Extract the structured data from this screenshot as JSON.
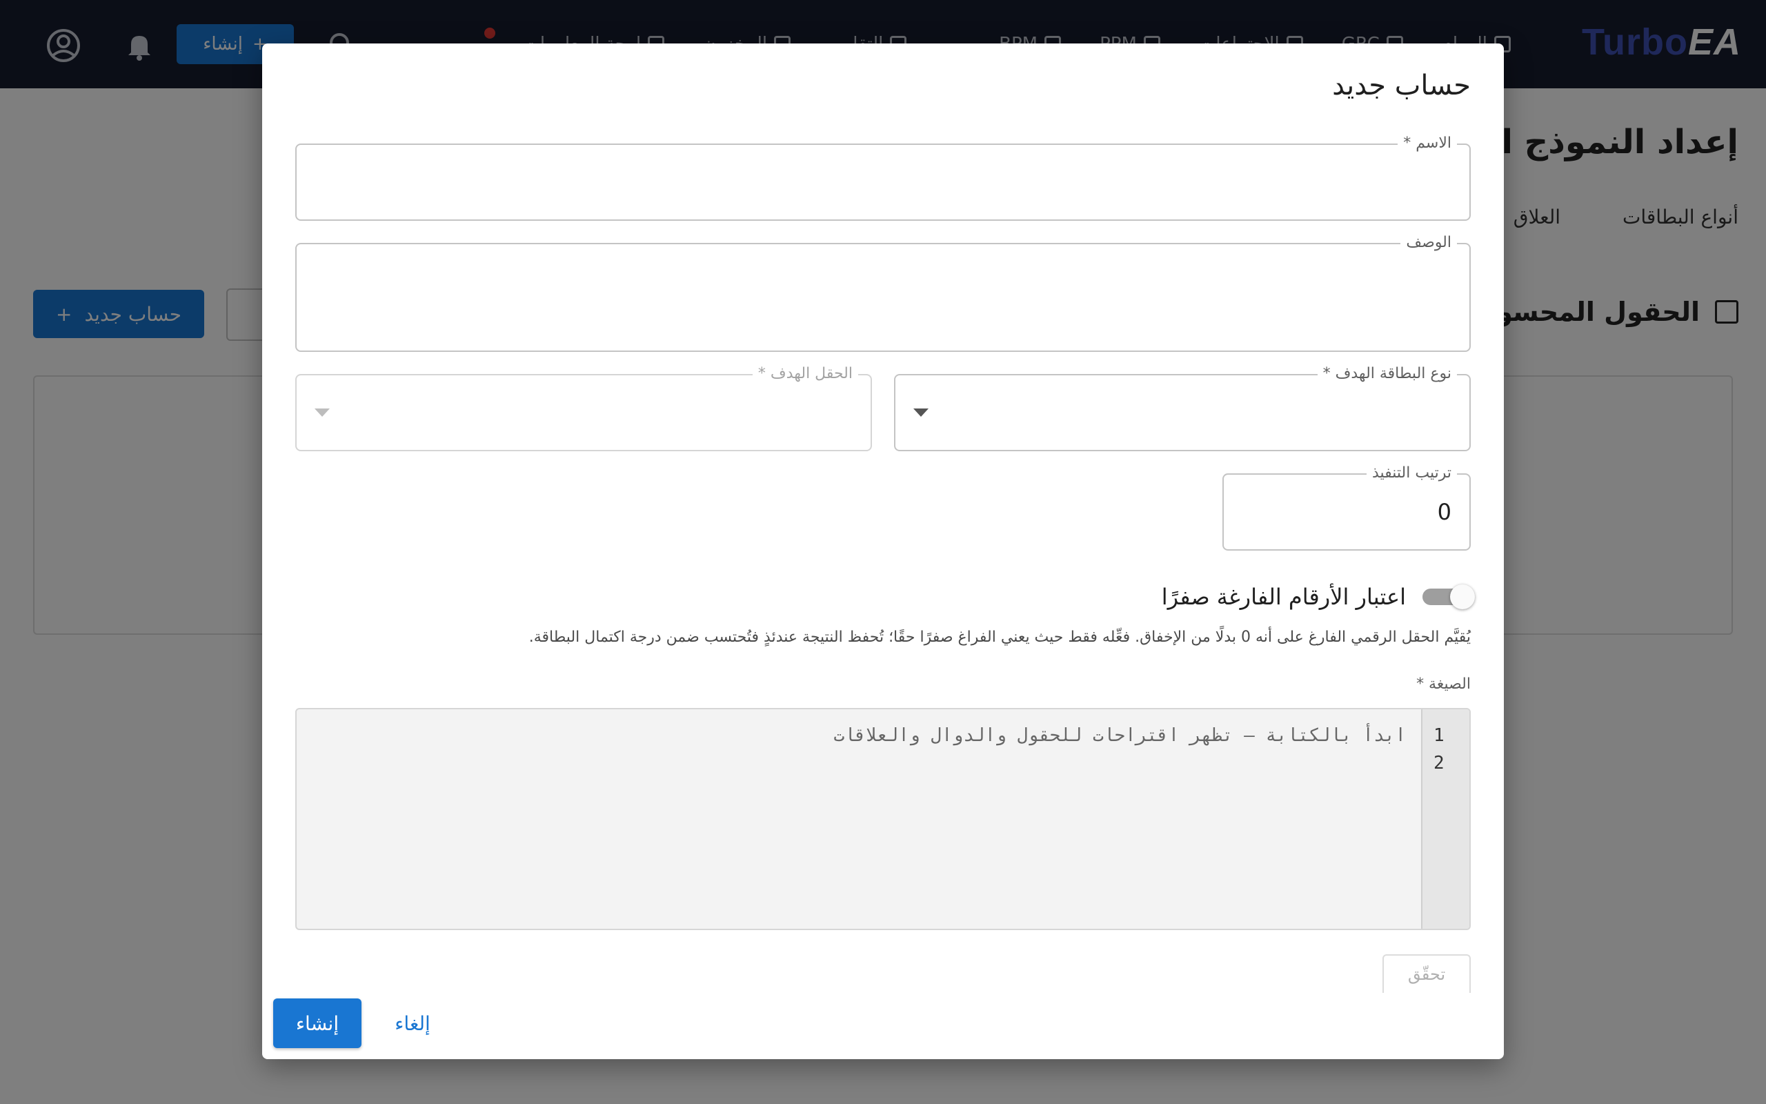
{
  "topbar": {
    "brand_part1": "Turbo",
    "brand_part2": "EA",
    "create_label": "إنشاء",
    "nav_items": [
      "لوحة المعلومات",
      "المخزون",
      "التقارير",
      "",
      "BPM",
      "PPM",
      "الاجتماعات",
      "GRC",
      "المهام"
    ],
    "icons": [
      "account-circle-icon",
      "bell-icon",
      "search-icon"
    ]
  },
  "background": {
    "page_title": "إعداد النموذج الو",
    "tabs": [
      "أنواع البطاقات",
      "العلاق"
    ],
    "section_title": "الحقول المحسو",
    "new_calc_button": "حساب جديد"
  },
  "dialog": {
    "title": "حساب جديد",
    "name_field": {
      "label": "الاسم *",
      "value": ""
    },
    "description_field": {
      "label": "الوصف",
      "value": ""
    },
    "target_card_type": {
      "label": "نوع البطاقة الهدف *",
      "value": ""
    },
    "target_field": {
      "label": "الحقل الهدف *",
      "value": "",
      "disabled": true
    },
    "execution_order": {
      "label": "ترتيب التنفيذ",
      "value": "0"
    },
    "treat_empty_as_zero": {
      "label": "اعتبار الأرقام الفارغة صفرًا",
      "enabled": false,
      "help": "يُقيَّم الحقل الرقمي الفارغ على أنه 0 بدلًا من الإخفاق. فعِّله فقط حيث يعني الفراغ صفرًا حقًا؛ تُحفظ النتيجة عندئذٍ فتُحتسب ضمن درجة اكتمال البطاقة."
    },
    "formula": {
      "label": "الصيغة *",
      "placeholder": "ابدأ بالكتابة — تظهر اقتراحات للحقول والدوال والعلاقات",
      "line_numbers": [
        "1",
        "2"
      ]
    },
    "validate_button": "تحقّق",
    "create_button": "إنشاء",
    "cancel_button": "إلغاء"
  },
  "colors": {
    "primary": "#1976d2",
    "topbar": "#161c2e",
    "brand_turbo": "#3f51b5"
  }
}
